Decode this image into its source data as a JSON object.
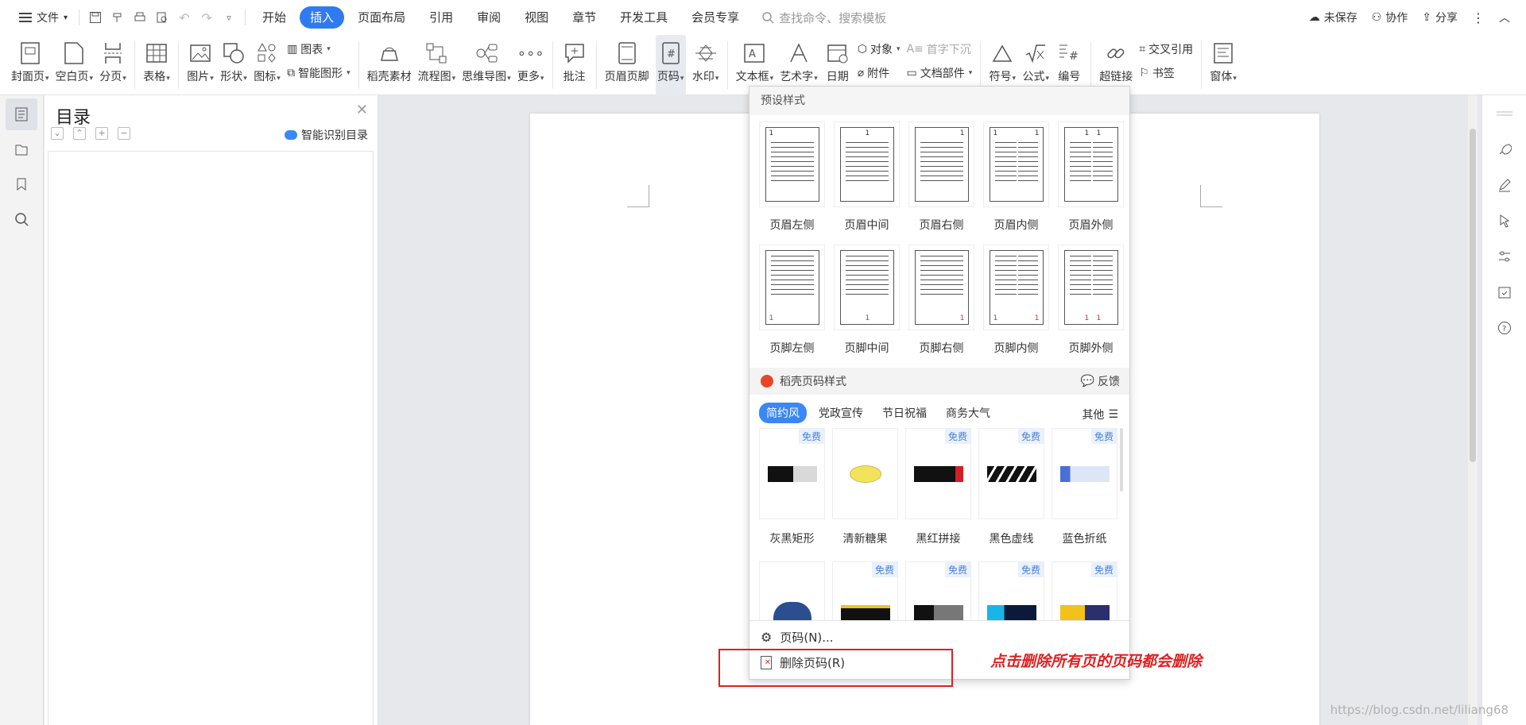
{
  "menu": {
    "file_label": "文件",
    "tabs": [
      "开始",
      "插入",
      "页面布局",
      "引用",
      "审阅",
      "视图",
      "章节",
      "开发工具",
      "会员专享"
    ],
    "active_tab": "插入",
    "search_placeholder": "查找命令、搜索模板",
    "unsaved": "未保存",
    "collab": "协作",
    "share": "分享"
  },
  "ribbon": {
    "cover": "封面页",
    "blank": "空白页",
    "break": "分页",
    "table": "表格",
    "picture": "图片",
    "shape": "形状",
    "icon": "图标",
    "chart": "图表",
    "smartart": "智能图形",
    "daoke": "稻壳素材",
    "flow": "流程图",
    "mindmap": "思维导图",
    "more": "更多",
    "comment": "批注",
    "header_footer": "页眉页脚",
    "page_number": "页码",
    "watermark": "水印",
    "textbox": "文本框",
    "wordart": "艺术字",
    "date": "日期",
    "object": "对象",
    "attachment": "附件",
    "dropcap": "首字下沉",
    "docpart": "文档部件",
    "symbol": "符号",
    "formula": "公式",
    "numbering": "编号",
    "hyperlink": "超链接",
    "crossref": "交叉引用",
    "bookmark": "书签",
    "window": "窗体"
  },
  "toc": {
    "title": "目录",
    "ai_label": "智能识别目录"
  },
  "dropdown": {
    "preset_title": "预设样式",
    "header_styles": [
      {
        "label": "页眉左侧",
        "num": "1"
      },
      {
        "label": "页眉中间",
        "num": "1"
      },
      {
        "label": "页眉右侧",
        "num": "1"
      },
      {
        "label": "页眉内侧",
        "num": "1"
      },
      {
        "label": "页眉外侧",
        "num": "1"
      }
    ],
    "footer_styles": [
      {
        "label": "页脚左侧",
        "num": "1"
      },
      {
        "label": "页脚中间",
        "num": "1"
      },
      {
        "label": "页脚右侧",
        "num": "1"
      },
      {
        "label": "页脚内侧",
        "num": "1"
      },
      {
        "label": "页脚外侧",
        "num": "1"
      }
    ],
    "daoke_title": "稻壳页码样式",
    "feedback": "反馈",
    "filter_tabs": [
      "简约风",
      "党政宣传",
      "节日祝福",
      "商务大气"
    ],
    "other": "其他",
    "free_badge": "免费",
    "templates_row1": [
      "灰黑矩形",
      "清新糖果",
      "黑红拼接",
      "黑色虚线",
      "蓝色折纸"
    ],
    "item_page_number": "页码(N)...",
    "item_delete": "删除页码(R)"
  },
  "annotation": "点击删除所有页的页码都会删除",
  "watermark_text": "https://blog.csdn.net/liliang68"
}
